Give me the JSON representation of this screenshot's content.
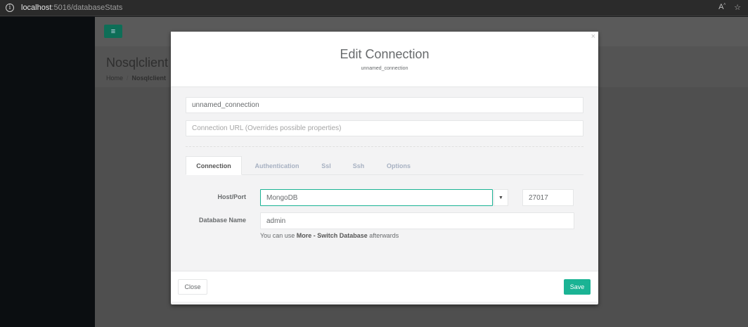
{
  "browser": {
    "url_host": "localhost",
    "url_path": ":5016/databaseStats"
  },
  "page": {
    "title": "Nosqlclient",
    "breadcrumb": [
      "Home",
      "Nosqlclient"
    ]
  },
  "modal": {
    "title": "Edit Connection",
    "subtitle": "unnamed_connection",
    "connection_name_value": "unnamed_connection",
    "connection_url_placeholder": "Connection URL (Overrides possible properties)",
    "tabs": [
      "Connection",
      "Authentication",
      "Ssl",
      "Ssh",
      "Options"
    ],
    "active_tab": "Connection",
    "host_port_label": "Host/Port",
    "host_value": "MongoDB",
    "port_value": "27017",
    "database_name_label": "Database Name",
    "database_name_value": "admin",
    "help_prefix": "You can use ",
    "help_bold": "More - Switch Database",
    "help_suffix": " afterwards",
    "close_label": "Close",
    "save_label": "Save"
  },
  "colors": {
    "accent": "#1ab394",
    "sidebar": "#0b0e11"
  }
}
